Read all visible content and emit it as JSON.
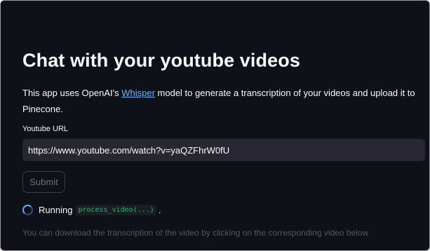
{
  "app": {
    "title": "Chat with your youtube videos",
    "description": {
      "prefix": "This app uses OpenAI's ",
      "link_text": "Whisper",
      "suffix": " model to generate a transcription of your videos and upload it to Pinecone."
    }
  },
  "form": {
    "url_label": "Youtube URL",
    "url_value": "https://www.youtube.com/watch?v=yaQZFhrW0fU",
    "submit_label": "Submit"
  },
  "status": {
    "running_label": "Running",
    "function_name": "process_video(...)",
    "suffix": "."
  },
  "caption": "You can download the transcription of the video by clicking on the corresponding video below",
  "colors": {
    "background": "#0e1117",
    "input_background": "#262730",
    "link": "#6bb3ff",
    "code_text": "#1dbc6a",
    "muted_text": "#55575e"
  }
}
